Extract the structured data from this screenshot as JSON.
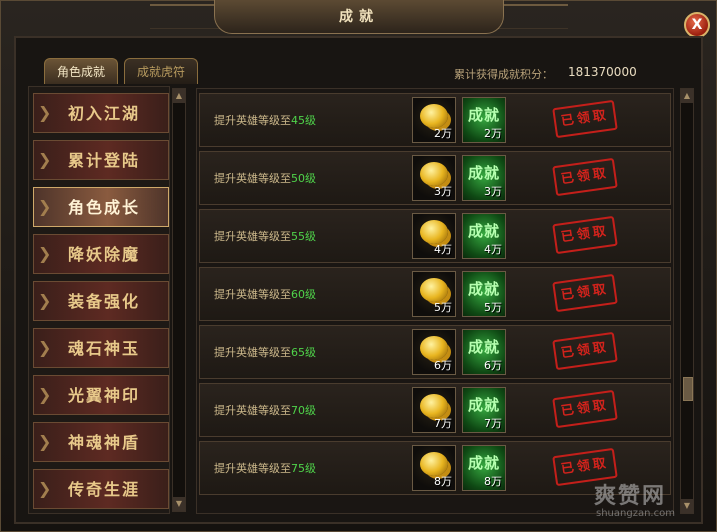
{
  "window": {
    "title": "成就",
    "close_label": "X"
  },
  "tabs": [
    {
      "label": "角色成就",
      "active": true
    },
    {
      "label": "成就虎符",
      "active": false
    }
  ],
  "score": {
    "label": "累计获得成就积分：",
    "value": "181370000"
  },
  "sidebar": {
    "items": [
      {
        "label": "初入江湖",
        "active": false
      },
      {
        "label": "累计登陆",
        "active": false
      },
      {
        "label": "角色成长",
        "active": true
      },
      {
        "label": "降妖除魔",
        "active": false
      },
      {
        "label": "装备强化",
        "active": false
      },
      {
        "label": "魂石神玉",
        "active": false
      },
      {
        "label": "光翼神印",
        "active": false
      },
      {
        "label": "神魂神盾",
        "active": false
      },
      {
        "label": "传奇生涯",
        "active": false
      }
    ]
  },
  "rewards_section": {
    "exp_icon_text": "成就",
    "status_text": "已领取",
    "rows": [
      {
        "prefix": "提升英雄等级至",
        "level": "45级",
        "gold_qty": "2万",
        "exp_qty": "2万"
      },
      {
        "prefix": "提升英雄等级至",
        "level": "50级",
        "gold_qty": "3万",
        "exp_qty": "3万"
      },
      {
        "prefix": "提升英雄等级至",
        "level": "55级",
        "gold_qty": "4万",
        "exp_qty": "4万"
      },
      {
        "prefix": "提升英雄等级至",
        "level": "60级",
        "gold_qty": "5万",
        "exp_qty": "5万"
      },
      {
        "prefix": "提升英雄等级至",
        "level": "65级",
        "gold_qty": "6万",
        "exp_qty": "6万"
      },
      {
        "prefix": "提升英雄等级至",
        "level": "70级",
        "gold_qty": "7万",
        "exp_qty": "7万"
      },
      {
        "prefix": "提升英雄等级至",
        "level": "75级",
        "gold_qty": "8万",
        "exp_qty": "8万"
      }
    ]
  },
  "watermark": {
    "text": "爽赞网",
    "sub": "shuangzan.com"
  },
  "colors": {
    "level_green": "#4fd34a",
    "stamp_red": "#d3231c",
    "accent_gold": "#e8c98a"
  }
}
